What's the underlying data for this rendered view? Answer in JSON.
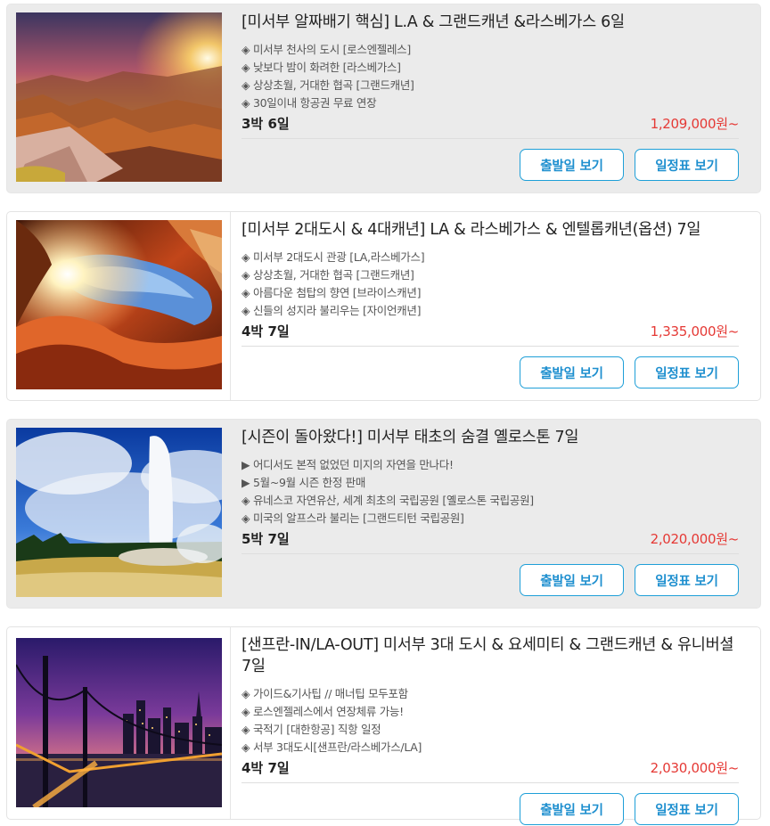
{
  "colors": {
    "accent": "#1e9fd8",
    "price": "#e53935",
    "shaded_card": "#ebebeb"
  },
  "tours": [
    {
      "image": "grand-canyon-sunset-photo",
      "title": "[미서부 알짜배기 핵심] L.A & 그랜드캐년 &라스베가스 6일",
      "bullets": [
        "◈ 미서부 천사의 도시 [로스엔젤레스]",
        "◈ 낮보다 밤이 화려한 [라스베가스]",
        "◈ 상상초월, 거대한 협곡 [그랜드캐년]",
        "◈ 30일이내 항공권 무료 연장"
      ],
      "duration": "3박 6일",
      "price": "1,209,000원~",
      "departure_button": "출발일 보기",
      "itinerary_button": "일정표 보기"
    },
    {
      "image": "antelope-canyon-photo",
      "title": "[미서부 2대도시 & 4대캐년] LA & 라스베가스 & 엔텔롭캐년(옵션) 7일",
      "bullets": [
        "◈ 미서부 2대도시 관광 [LA,라스베가스]",
        "◈ 상상초월, 거대한 협곡 [그랜드캐년]",
        "◈ 아름다운 첨탑의 향연 [브라이스캐년]",
        "◈ 신들의 성지라 불리우는 [자이언캐년]"
      ],
      "duration": "4박 7일",
      "price": "1,335,000원~",
      "departure_button": "출발일 보기",
      "itinerary_button": "일정표 보기"
    },
    {
      "image": "yellowstone-geyser-photo",
      "title": "[시즌이 돌아왔다!] 미서부 태초의 숨결 옐로스톤 7일",
      "bullets": [
        "▶ 어디서도 본적 없었던 미지의 자연을 만나다!",
        "▶ 5월~9월 시즌 한정 판매",
        "◈ 유네스코 자연유산, 세계 최초의 국립공원 [옐로스톤 국립공원]",
        "◈ 미국의 알프스라 불리는 [그랜드티턴 국립공원]"
      ],
      "duration": "5박 7일",
      "price": "2,020,000원~",
      "departure_button": "출발일 보기",
      "itinerary_button": "일정표 보기"
    },
    {
      "image": "san-francisco-bay-bridge-photo",
      "title": "[샌프란-IN/LA-OUT] 미서부 3대 도시 & 요세미티 & 그랜드캐년 & 유니버셜 7일",
      "bullets": [
        "◈ 가이드&기사팁 // 매너팁 모두포함",
        "◈ 로스엔젤레스에서 연장체류 가능!",
        "◈ 국적기 [대한항공] 직항 일정",
        "◈ 서부 3대도시[샌프란/라스베가스/LA]"
      ],
      "duration": "4박 7일",
      "price": "2,030,000원~",
      "departure_button": "출발일 보기",
      "itinerary_button": "일정표 보기"
    }
  ]
}
